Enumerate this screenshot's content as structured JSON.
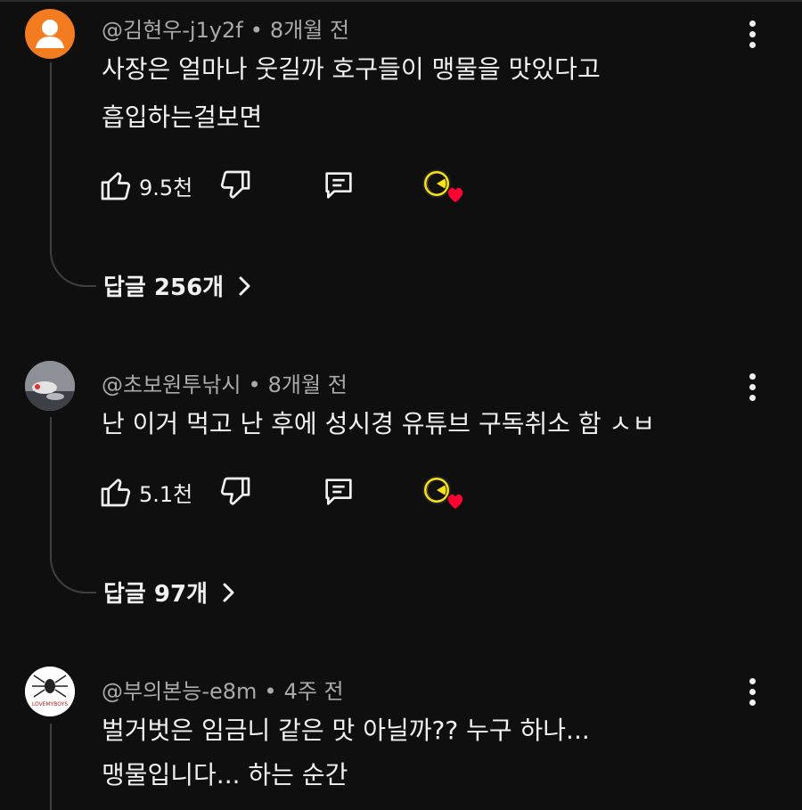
{
  "comments": [
    {
      "author": "@김현우-j1y2f",
      "time": "8개월 전",
      "lines": [
        "사장은 얼마나 웃길까 호구들이 맹물을 맛있다고",
        "흡입하는걸보면"
      ],
      "likes": "9.5천",
      "replies_label": "답글 256개",
      "avatar_color": "#f47c20"
    },
    {
      "author": "@초보원투낚시",
      "time": "8개월 전",
      "lines": [
        "난 이거 먹고 난 후에 성시경 유튜브 구독취소 함 ㅅㅂ"
      ],
      "likes": "5.1천",
      "replies_label": "답글 97개"
    },
    {
      "author": "@부의본능-e8m",
      "time": "4주 전",
      "lines": [
        "벌거벗은 임금니 같은 맛 아닐까?? 누구 하나...",
        "맹물입니다... 하는 순간"
      ],
      "avatar_text": "LOVEMYBOYS"
    }
  ],
  "meta_separator": "•",
  "icons": {
    "like": "thumbs-up-icon",
    "dislike": "thumbs-down-icon",
    "reply": "comment-icon",
    "creator_heart": "creator-heart-badge",
    "more": "more-vert-icon",
    "replies_chevron": "chevron-right-icon"
  },
  "colors": {
    "background": "#0f0f0f",
    "text": "#f1f1f1",
    "meta": "#aaaaaa",
    "heart": "#ff0033",
    "badge_yellow": "#f7e21a"
  }
}
